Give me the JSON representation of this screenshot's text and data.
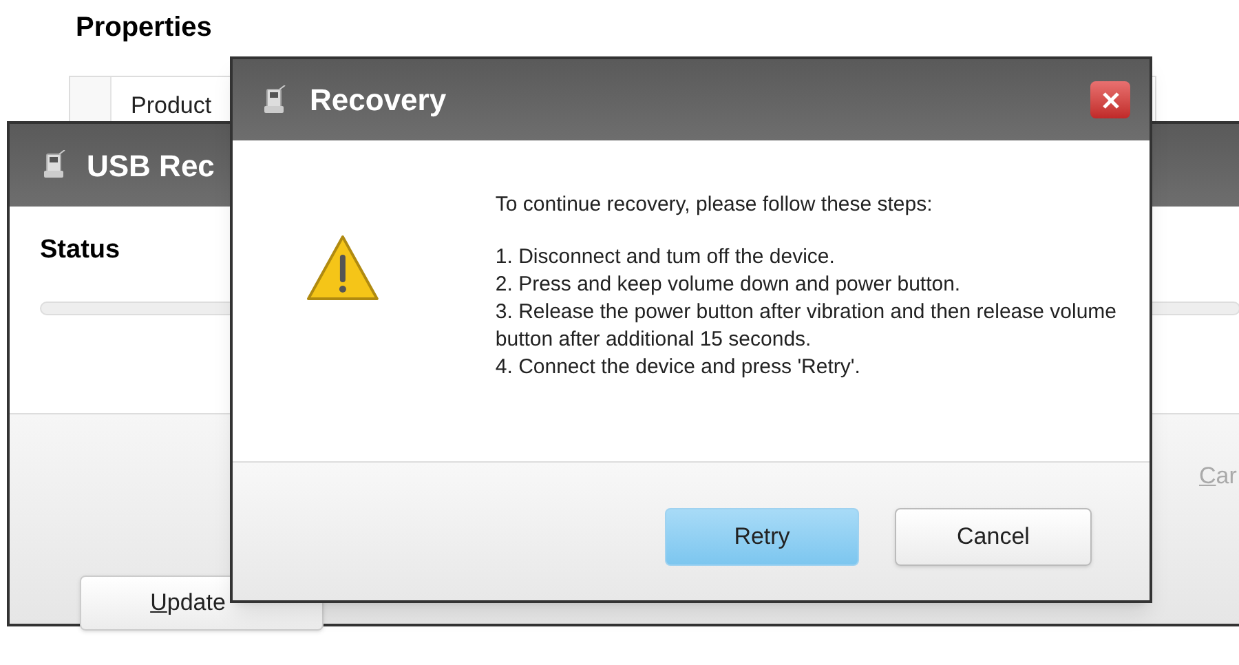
{
  "page": {
    "title": "Properties",
    "table": {
      "columns": [
        "Product"
      ]
    },
    "update_button": {
      "label": "Update"
    }
  },
  "usb_window": {
    "title": "USB Rec",
    "status_heading": "Status",
    "cancel_button": {
      "label": "Car"
    }
  },
  "dialog": {
    "title": "Recovery",
    "intro": "To continue recovery, please follow these steps:",
    "steps": [
      "1. Disconnect and tum off the device.",
      "2. Press and keep volume down and power button.",
      "3. Release the power button after vibration and then release volume button after additional 15 seconds.",
      "4. Connect the device and press 'Retry'."
    ],
    "buttons": [
      {
        "label": "Retry",
        "selected": true
      },
      {
        "label": "Cancel",
        "selected": false
      }
    ]
  }
}
